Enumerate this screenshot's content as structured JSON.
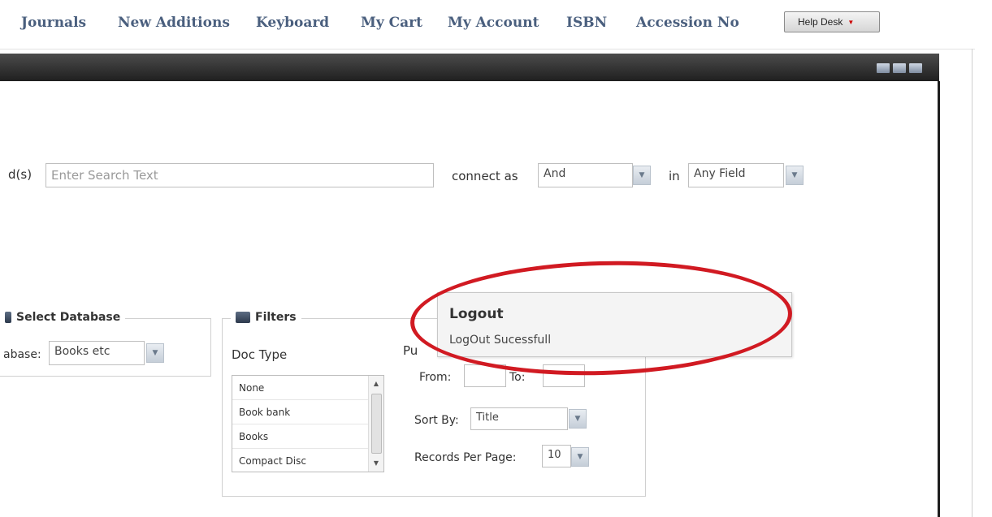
{
  "nav": {
    "items": [
      {
        "label": "Journals"
      },
      {
        "label": "New Additions"
      },
      {
        "label": "Keyboard"
      },
      {
        "label": "My Cart"
      },
      {
        "label": "My Account"
      },
      {
        "label": "ISBN"
      },
      {
        "label": "Accession No"
      }
    ],
    "help_desk": "Help Desk"
  },
  "search": {
    "keywords_label": "d(s)",
    "search_placeholder": "Enter Search Text",
    "connect_label": "connect as",
    "connect_value": "And",
    "in_label": "in",
    "field_value": "Any Field"
  },
  "database_panel": {
    "legend": "Select Database",
    "label": "abase:",
    "value": "Books etc"
  },
  "filters": {
    "legend": "Filters",
    "doc_type_label": "Doc Type",
    "doc_types": [
      "None",
      "Book bank",
      "Books",
      "Compact Disc"
    ],
    "pub_label": "Pu",
    "from_label": "From:",
    "to_label": "To:",
    "sort_label": "Sort By:",
    "sort_value": "Title",
    "records_label": "Records Per Page:",
    "records_value": "10"
  },
  "toast": {
    "title": "Logout",
    "message": "LogOut Sucessfull"
  },
  "colors": {
    "nav_text": "#4a5f7e",
    "highlight": "#d11a22",
    "titlebar": "#2b2b2b"
  }
}
